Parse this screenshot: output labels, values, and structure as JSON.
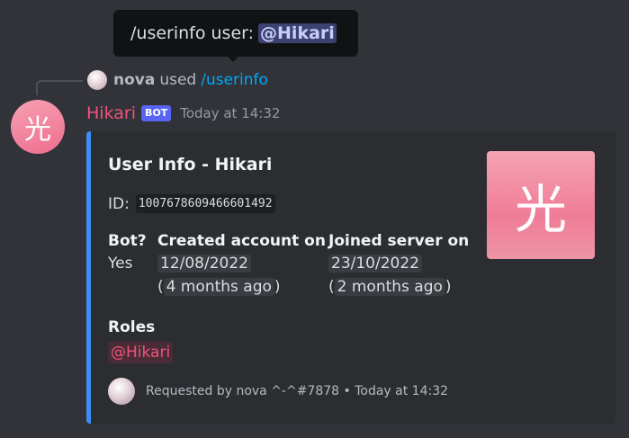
{
  "tooltip": {
    "prefix": "/userinfo user:",
    "mention": "@Hikari"
  },
  "reply": {
    "username": "nova",
    "used_text": "used",
    "command": "/userinfo"
  },
  "message": {
    "avatar_glyph": "光",
    "author": "Hikari",
    "bot_tag": "BOT",
    "timestamp": "Today at 14:32"
  },
  "embed": {
    "accent_color": "#3a8dfc",
    "title": "User Info - Hikari",
    "id_label": "ID:",
    "id_value": "1007678609466601492",
    "thumbnail_glyph": "光",
    "fields": [
      {
        "name": "Bot?",
        "value": "Yes"
      },
      {
        "name": "Created account on",
        "date": "12/08/2022",
        "relative": "4 months ago"
      },
      {
        "name": "Joined server on",
        "date": "23/10/2022",
        "relative": "2 months ago"
      }
    ],
    "roles_label": "Roles",
    "role_mention": "@Hikari",
    "footer_text": "Requested by nova ^-^#7878 • Today at 14:32"
  },
  "colors": {
    "background": "#313338",
    "embed_bg": "#2b2d31",
    "author_color": "#f0527e",
    "bot_tag_bg": "#5865f2",
    "command_link": "#00a8fc"
  }
}
